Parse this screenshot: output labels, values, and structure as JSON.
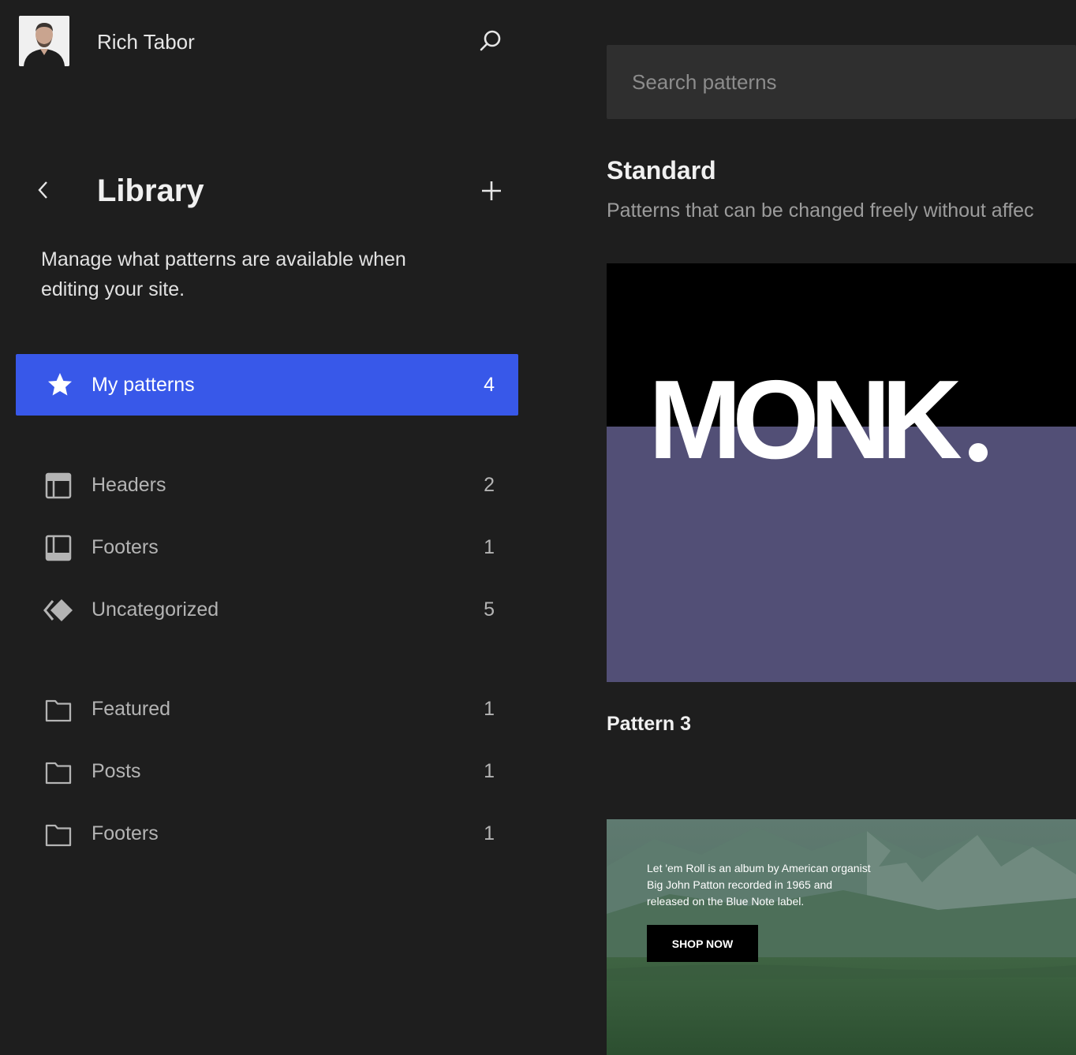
{
  "site": {
    "name": "Rich Tabor"
  },
  "icons": {
    "search": "search-icon",
    "back": "chevron-left-icon",
    "add": "plus-icon",
    "star": "star-icon",
    "header": "header-layout-icon",
    "footer": "footer-layout-icon",
    "uncategorized": "symbol-diamond-icon",
    "folder": "folder-icon"
  },
  "colors": {
    "accent": "#3858e9",
    "background": "#1e1e1e",
    "muted_text": "#b4b4b4",
    "card_purple": "#524f76"
  },
  "library": {
    "title": "Library",
    "description": "Manage what patterns are available when editing your site."
  },
  "nav": {
    "my_patterns": {
      "label": "My patterns",
      "count": "4"
    },
    "template_parts": [
      {
        "label": "Headers",
        "count": "2"
      },
      {
        "label": "Footers",
        "count": "1"
      },
      {
        "label": "Uncategorized",
        "count": "5"
      }
    ],
    "categories": [
      {
        "label": "Featured",
        "count": "1"
      },
      {
        "label": "Posts",
        "count": "1"
      },
      {
        "label": "Footers",
        "count": "1"
      }
    ]
  },
  "main": {
    "search": {
      "placeholder": "Search patterns"
    },
    "section": {
      "title": "Standard",
      "description": "Patterns that can be changed freely without affec"
    },
    "cards": [
      {
        "preview_text": "MONK",
        "label": "Pattern 3"
      },
      {
        "blurb": "Let 'em Roll is an album by American organist Big John Patton recorded in 1965 and released on the Blue Note label.",
        "button": "SHOP NOW"
      }
    ]
  }
}
